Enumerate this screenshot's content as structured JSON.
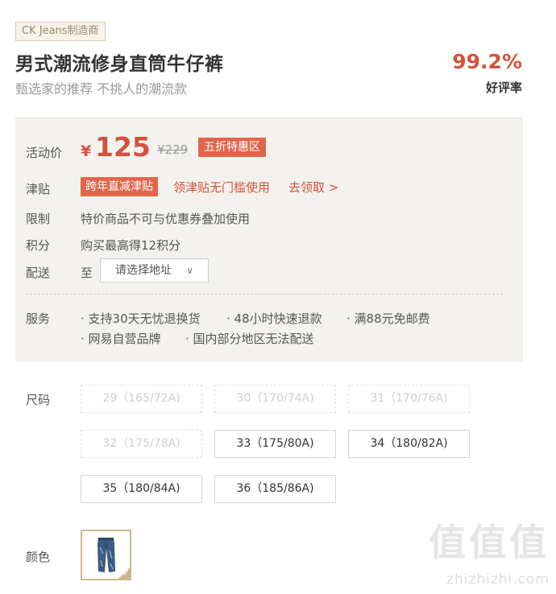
{
  "product": {
    "brand_tag": "CK Jeans制造商",
    "title": "男式潮流修身直筒牛仔裤",
    "subtitle": "甄选家的推荐 不挑人的潮流款",
    "rating_value": "99.2%",
    "rating_label": "好评率"
  },
  "price": {
    "label": "活动价",
    "currency": "¥",
    "value": "125",
    "original": "¥229",
    "badge": "五折特惠区"
  },
  "subsidy": {
    "label": "津贴",
    "badge": "跨年直减津贴",
    "link": "领津贴无门槛使用",
    "get": "去领取 >"
  },
  "limit": {
    "label": "限制",
    "text": "特价商品不可与优惠券叠加使用"
  },
  "points": {
    "label": "积分",
    "text": "购买最高得12积分"
  },
  "shipping": {
    "label": "配送",
    "to": "至",
    "address_placeholder": "请选择地址",
    "chevron": "∨"
  },
  "services": {
    "label": "服务",
    "items": [
      "· 支持30天无忧退换货",
      "· 48小时快速退款",
      "· 满88元免邮费",
      "· 网易自营品牌",
      "· 国内部分地区无法配送"
    ]
  },
  "sizes": {
    "label": "尺码",
    "options": [
      {
        "text": "29（165/72A)",
        "available": false
      },
      {
        "text": "30（170/74A)",
        "available": false
      },
      {
        "text": "31（170/76A)",
        "available": false
      },
      {
        "text": "32（175/78A)",
        "available": false
      },
      {
        "text": "33（175/80A)",
        "available": true
      },
      {
        "text": "34（180/82A)",
        "available": true
      },
      {
        "text": "35（180/84A)",
        "available": true
      },
      {
        "text": "36（185/86A)",
        "available": true
      }
    ]
  },
  "colors": {
    "label": "颜色"
  },
  "watermark": {
    "main": "值值值",
    "sub": "zhizhizhi.com"
  },
  "theme": {
    "accent": "#d4523c",
    "badge": "#e2654b",
    "panel_bg": "#f4f2ee",
    "gold": "#c9b98e"
  }
}
